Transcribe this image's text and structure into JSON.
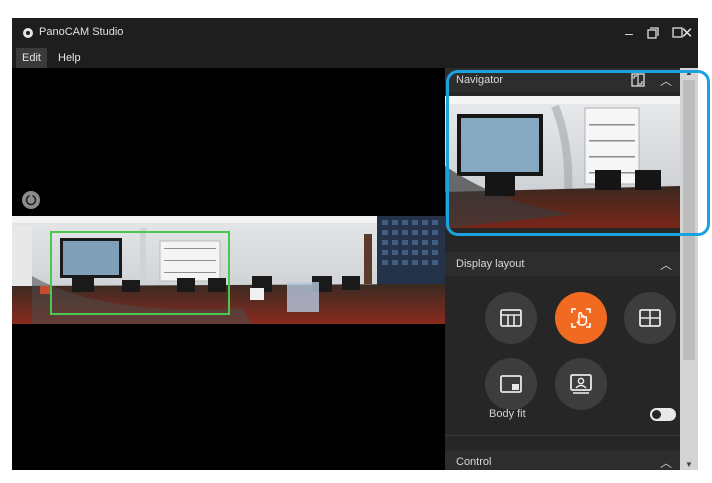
{
  "app": {
    "title": "PanoCAM Studio",
    "logo_icon": "gear-logo-icon"
  },
  "window_controls": {
    "compact_icon": "compact-view-icon",
    "minimize_icon": "minimize-icon",
    "maximize_icon": "maximize-icon",
    "close_icon": "close-icon"
  },
  "menu": {
    "items": [
      {
        "label": "Edit",
        "active": true
      },
      {
        "label": "Help",
        "active": false
      }
    ]
  },
  "viewport": {
    "rotate_icon": "rotate-icon",
    "selection_color": "#4bc84b"
  },
  "panel": {
    "navigator": {
      "title": "Navigator",
      "expand_icon": "expand-view-icon",
      "collapse_icon": "chevron-up-icon"
    },
    "display_layout": {
      "title": "Display layout",
      "collapse_icon": "chevron-up-icon",
      "buttons": [
        {
          "icon": "three-panel-layout-icon",
          "active": false
        },
        {
          "icon": "hand-pointer-layout-icon",
          "active": true
        },
        {
          "icon": "four-grid-layout-icon",
          "active": false
        },
        {
          "icon": "picture-in-picture-layout-icon",
          "active": false
        },
        {
          "icon": "presenter-layout-icon",
          "active": false
        }
      ],
      "body_fit": {
        "label": "Body fit",
        "enabled": false
      }
    },
    "control": {
      "title": "Control",
      "collapse_icon": "chevron-up-icon"
    }
  },
  "colors": {
    "accent": "#f06a22",
    "highlight": "#1aa3e0",
    "panel_bg": "#262626"
  }
}
